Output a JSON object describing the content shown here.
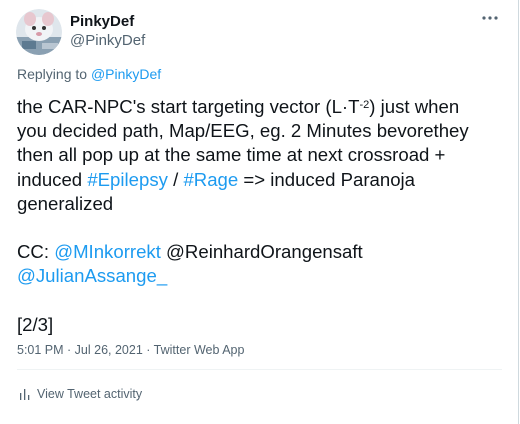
{
  "author": {
    "display_name": "PinkyDef",
    "handle": "@PinkyDef"
  },
  "reply": {
    "prefix": "Replying to ",
    "target": "@PinkyDef"
  },
  "tweet": {
    "line1_a": "the CAR-NPC's start targeting vector (L·T",
    "line1_sup": "-2",
    "line1_b": ") just when",
    "line2": "you decided path, Map/EEG, eg. 2 Minutes bevorethey",
    "line3": "then all pop up at the same time at next crossroad +",
    "line4_a": "induced ",
    "hashtag1": "#Epilepsy",
    "line4_b": " / ",
    "hashtag2": "#Rage",
    "line4_c": " => induced Paranoja",
    "line5": "generalized",
    "cc_prefix": "CC: ",
    "mention1": "@MInkorrekt",
    "cc_middle": " @ReinhardOrangensaft",
    "mention2": "@JulianAssange_",
    "counter": "[2/3]"
  },
  "meta": {
    "time": "5:01 PM",
    "sep": " · ",
    "date": "Jul 26, 2021",
    "source": "Twitter Web App"
  },
  "activity": {
    "label": "View Tweet activity"
  },
  "icons": {
    "more": "more-icon",
    "activity": "bar-chart-icon"
  },
  "colors": {
    "link": "#1d9bf0",
    "secondary": "#536471",
    "text": "#0f1419"
  }
}
